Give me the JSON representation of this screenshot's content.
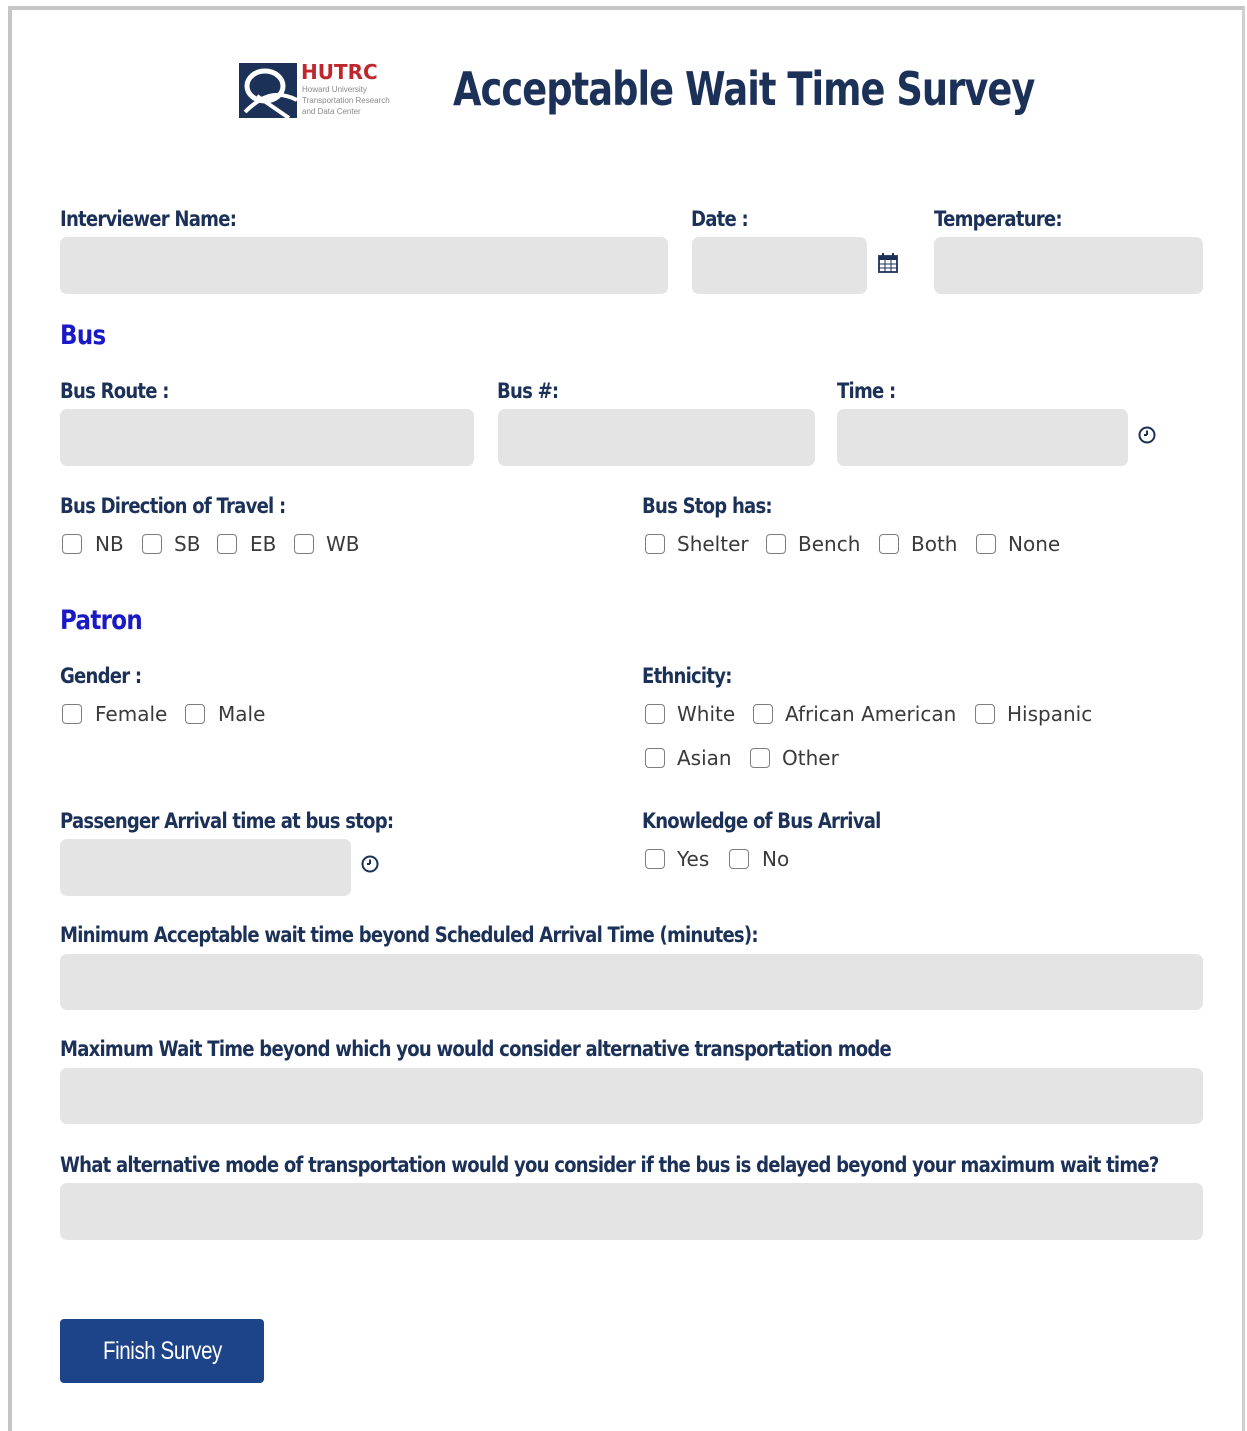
{
  "header": {
    "logo_name": "HUTRC",
    "logo_sub1": "Howard University",
    "logo_sub2": "Transportation Research",
    "logo_sub3": "and Data Center",
    "title": "Acceptable Wait Time Survey"
  },
  "fields": {
    "interviewer_label": "Interviewer Name:",
    "date_label": "Date :",
    "temperature_label": "Temperature:",
    "bus_route_label": "Bus Route :",
    "bus_num_label": "Bus #:",
    "time_label": "Time :",
    "arrival_label": "Passenger Arrival time at bus stop:",
    "min_wait_label": "Minimum Acceptable wait time beyond Scheduled Arrival Time (minutes):",
    "max_wait_label": "Maximum Wait Time beyond which you would consider alternative transportation mode",
    "alt_mode_label": "What alternative mode of transportation would you consider if the bus is delayed beyond your maximum wait time?"
  },
  "sections": {
    "bus": "Bus",
    "patron": "Patron"
  },
  "direction": {
    "label": "Bus Direction of Travel :",
    "options": [
      "NB",
      "SB",
      "EB",
      "WB"
    ]
  },
  "stop_has": {
    "label": "Bus Stop has:",
    "options": [
      "Shelter",
      "Bench",
      "Both",
      "None"
    ]
  },
  "gender": {
    "label": "Gender :",
    "options": [
      "Female",
      "Male"
    ]
  },
  "ethnicity": {
    "label": "Ethnicity:",
    "options": [
      "White",
      "African American",
      "Hispanic",
      "Asian",
      "Other"
    ]
  },
  "knowledge": {
    "label": "Knowledge of Bus Arrival",
    "options": [
      "Yes",
      "No"
    ]
  },
  "actions": {
    "finish_label": "Finish Survey"
  },
  "icons": {
    "calendar": "calendar-icon",
    "clock": "clock-icon"
  },
  "colors": {
    "label": "#1c3158",
    "section": "#1a19c6",
    "button": "#1d4388",
    "field": "#e4e4e4"
  }
}
